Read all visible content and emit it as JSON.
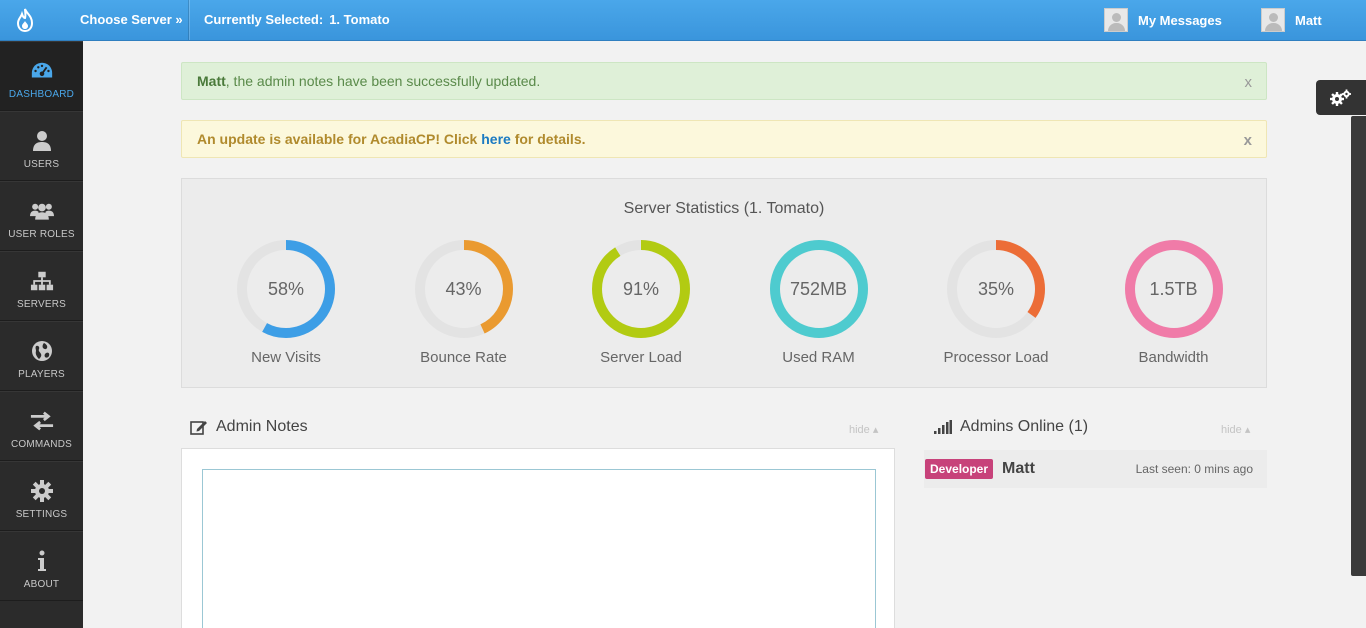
{
  "topbar": {
    "choose_server": "Choose Server »",
    "current_label": "Currently Selected:",
    "current_server": "1. Tomato",
    "messages": "My Messages",
    "user": "Matt"
  },
  "sidebar": {
    "items": [
      {
        "label": "DASHBOARD",
        "icon": "dashboard-icon",
        "active": true
      },
      {
        "label": "USERS",
        "icon": "user-icon"
      },
      {
        "label": "USER ROLES",
        "icon": "user-group-icon"
      },
      {
        "label": "SERVERS",
        "icon": "sitemap-icon"
      },
      {
        "label": "PLAYERS",
        "icon": "globe-icon"
      },
      {
        "label": "COMMANDS",
        "icon": "exchange-arrows-icon"
      },
      {
        "label": "SETTINGS",
        "icon": "gear-icon"
      },
      {
        "label": "ABOUT",
        "icon": "info-icon"
      }
    ]
  },
  "alerts": {
    "success_name": "Matt",
    "success_text": ", the admin notes have been successfully updated.",
    "warning_pre": "An update is available for AcadiaCP! Click ",
    "warning_link": "here",
    "warning_post": " for details.",
    "close": "x"
  },
  "stats": {
    "title": "Server Statistics (1. Tomato)",
    "items": [
      {
        "value": "58%",
        "label": "New Visits",
        "fraction": 0.58,
        "color": "#3d9ee6"
      },
      {
        "value": "43%",
        "label": "Bounce Rate",
        "fraction": 0.43,
        "color": "#ea9a30"
      },
      {
        "value": "91%",
        "label": "Server Load",
        "fraction": 0.91,
        "color": "#b2cb12"
      },
      {
        "value": "752MB",
        "label": "Used RAM",
        "fraction": 1.0,
        "color": "#4ecbcf"
      },
      {
        "value": "35%",
        "label": "Processor Load",
        "fraction": 0.35,
        "color": "#ec6d37"
      },
      {
        "value": "1.5TB",
        "label": "Bandwidth",
        "fraction": 1.0,
        "color": "#f07ba8"
      }
    ]
  },
  "notes": {
    "title": "Admin Notes",
    "hide": "hide ▴"
  },
  "admins": {
    "title": "Admins Online (1)",
    "hide": "hide ▴",
    "badge": "Developer",
    "name": "Matt",
    "last_seen": "Last seen: 0 mins ago"
  },
  "colors": {
    "topbar": "#4aa7ea",
    "sidebar": "#2b2b2b",
    "donut_track": "#e3e3e3"
  }
}
